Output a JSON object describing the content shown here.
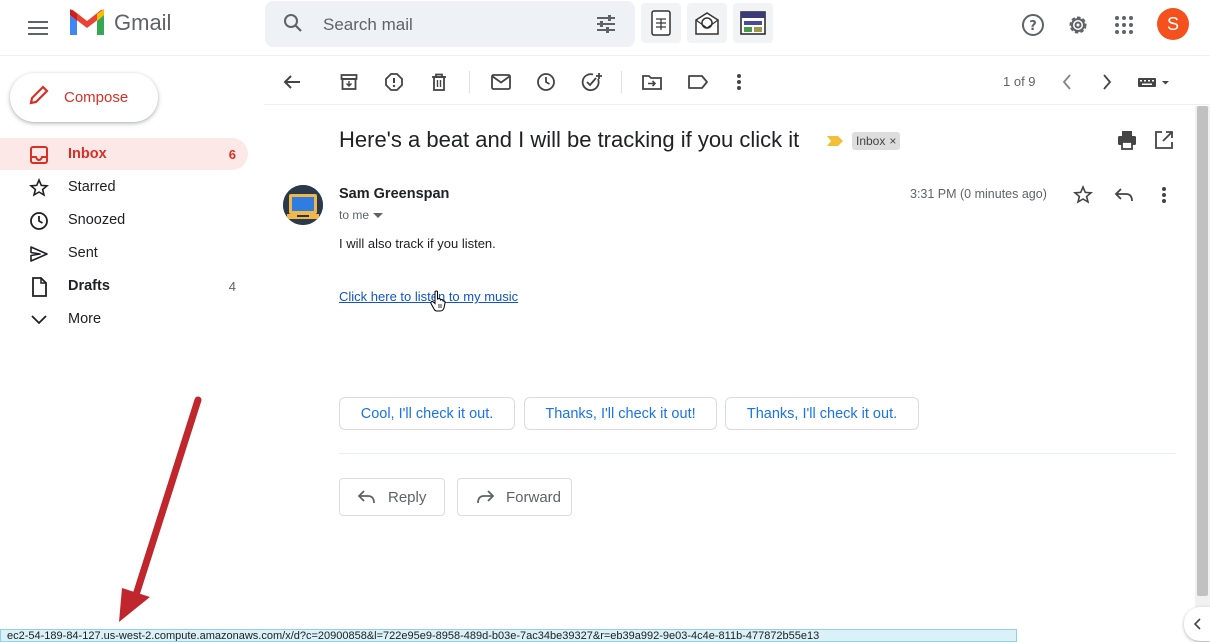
{
  "app": {
    "logo_text": "Gmail",
    "avatar_initial": "S",
    "avatar_color": "#f4511e",
    "accent": "#d93025"
  },
  "search": {
    "placeholder": "Search mail"
  },
  "compose": {
    "label": "Compose"
  },
  "sidebar": {
    "items": [
      {
        "label": "Inbox",
        "count": "6",
        "icon": "inbox-icon",
        "active": true
      },
      {
        "label": "Starred",
        "count": "",
        "icon": "star-icon"
      },
      {
        "label": "Snoozed",
        "count": "",
        "icon": "clock-icon"
      },
      {
        "label": "Sent",
        "count": "",
        "icon": "send-icon"
      },
      {
        "label": "Drafts",
        "count": "4",
        "icon": "draft-icon"
      },
      {
        "label": "More",
        "count": "",
        "icon": "chevron-down-icon"
      }
    ]
  },
  "toolbar": {
    "pager": "1 of 9"
  },
  "email": {
    "subject": "Here's a beat and I will be tracking if you click it",
    "label_chip": "Inbox",
    "sender": "Sam Greenspan",
    "to": "to me",
    "time": "3:31 PM (0 minutes ago)",
    "body": "I will also track if you listen.",
    "link": "Click here to listen to my music"
  },
  "smart_replies": [
    "Cool, I'll check it out.",
    "Thanks, I'll check it out!",
    "Thanks, I'll check it out."
  ],
  "actions": {
    "reply": "Reply",
    "forward": "Forward"
  },
  "status_bar": {
    "url": "ec2-54-189-84-127.us-west-2.compute.amazonaws.com/x/d?c=20900858&l=722e95e9-8958-489d-b03e-7ac34be39327&r=eb39a992-9e03-4c4e-811b-477872b55e13"
  }
}
